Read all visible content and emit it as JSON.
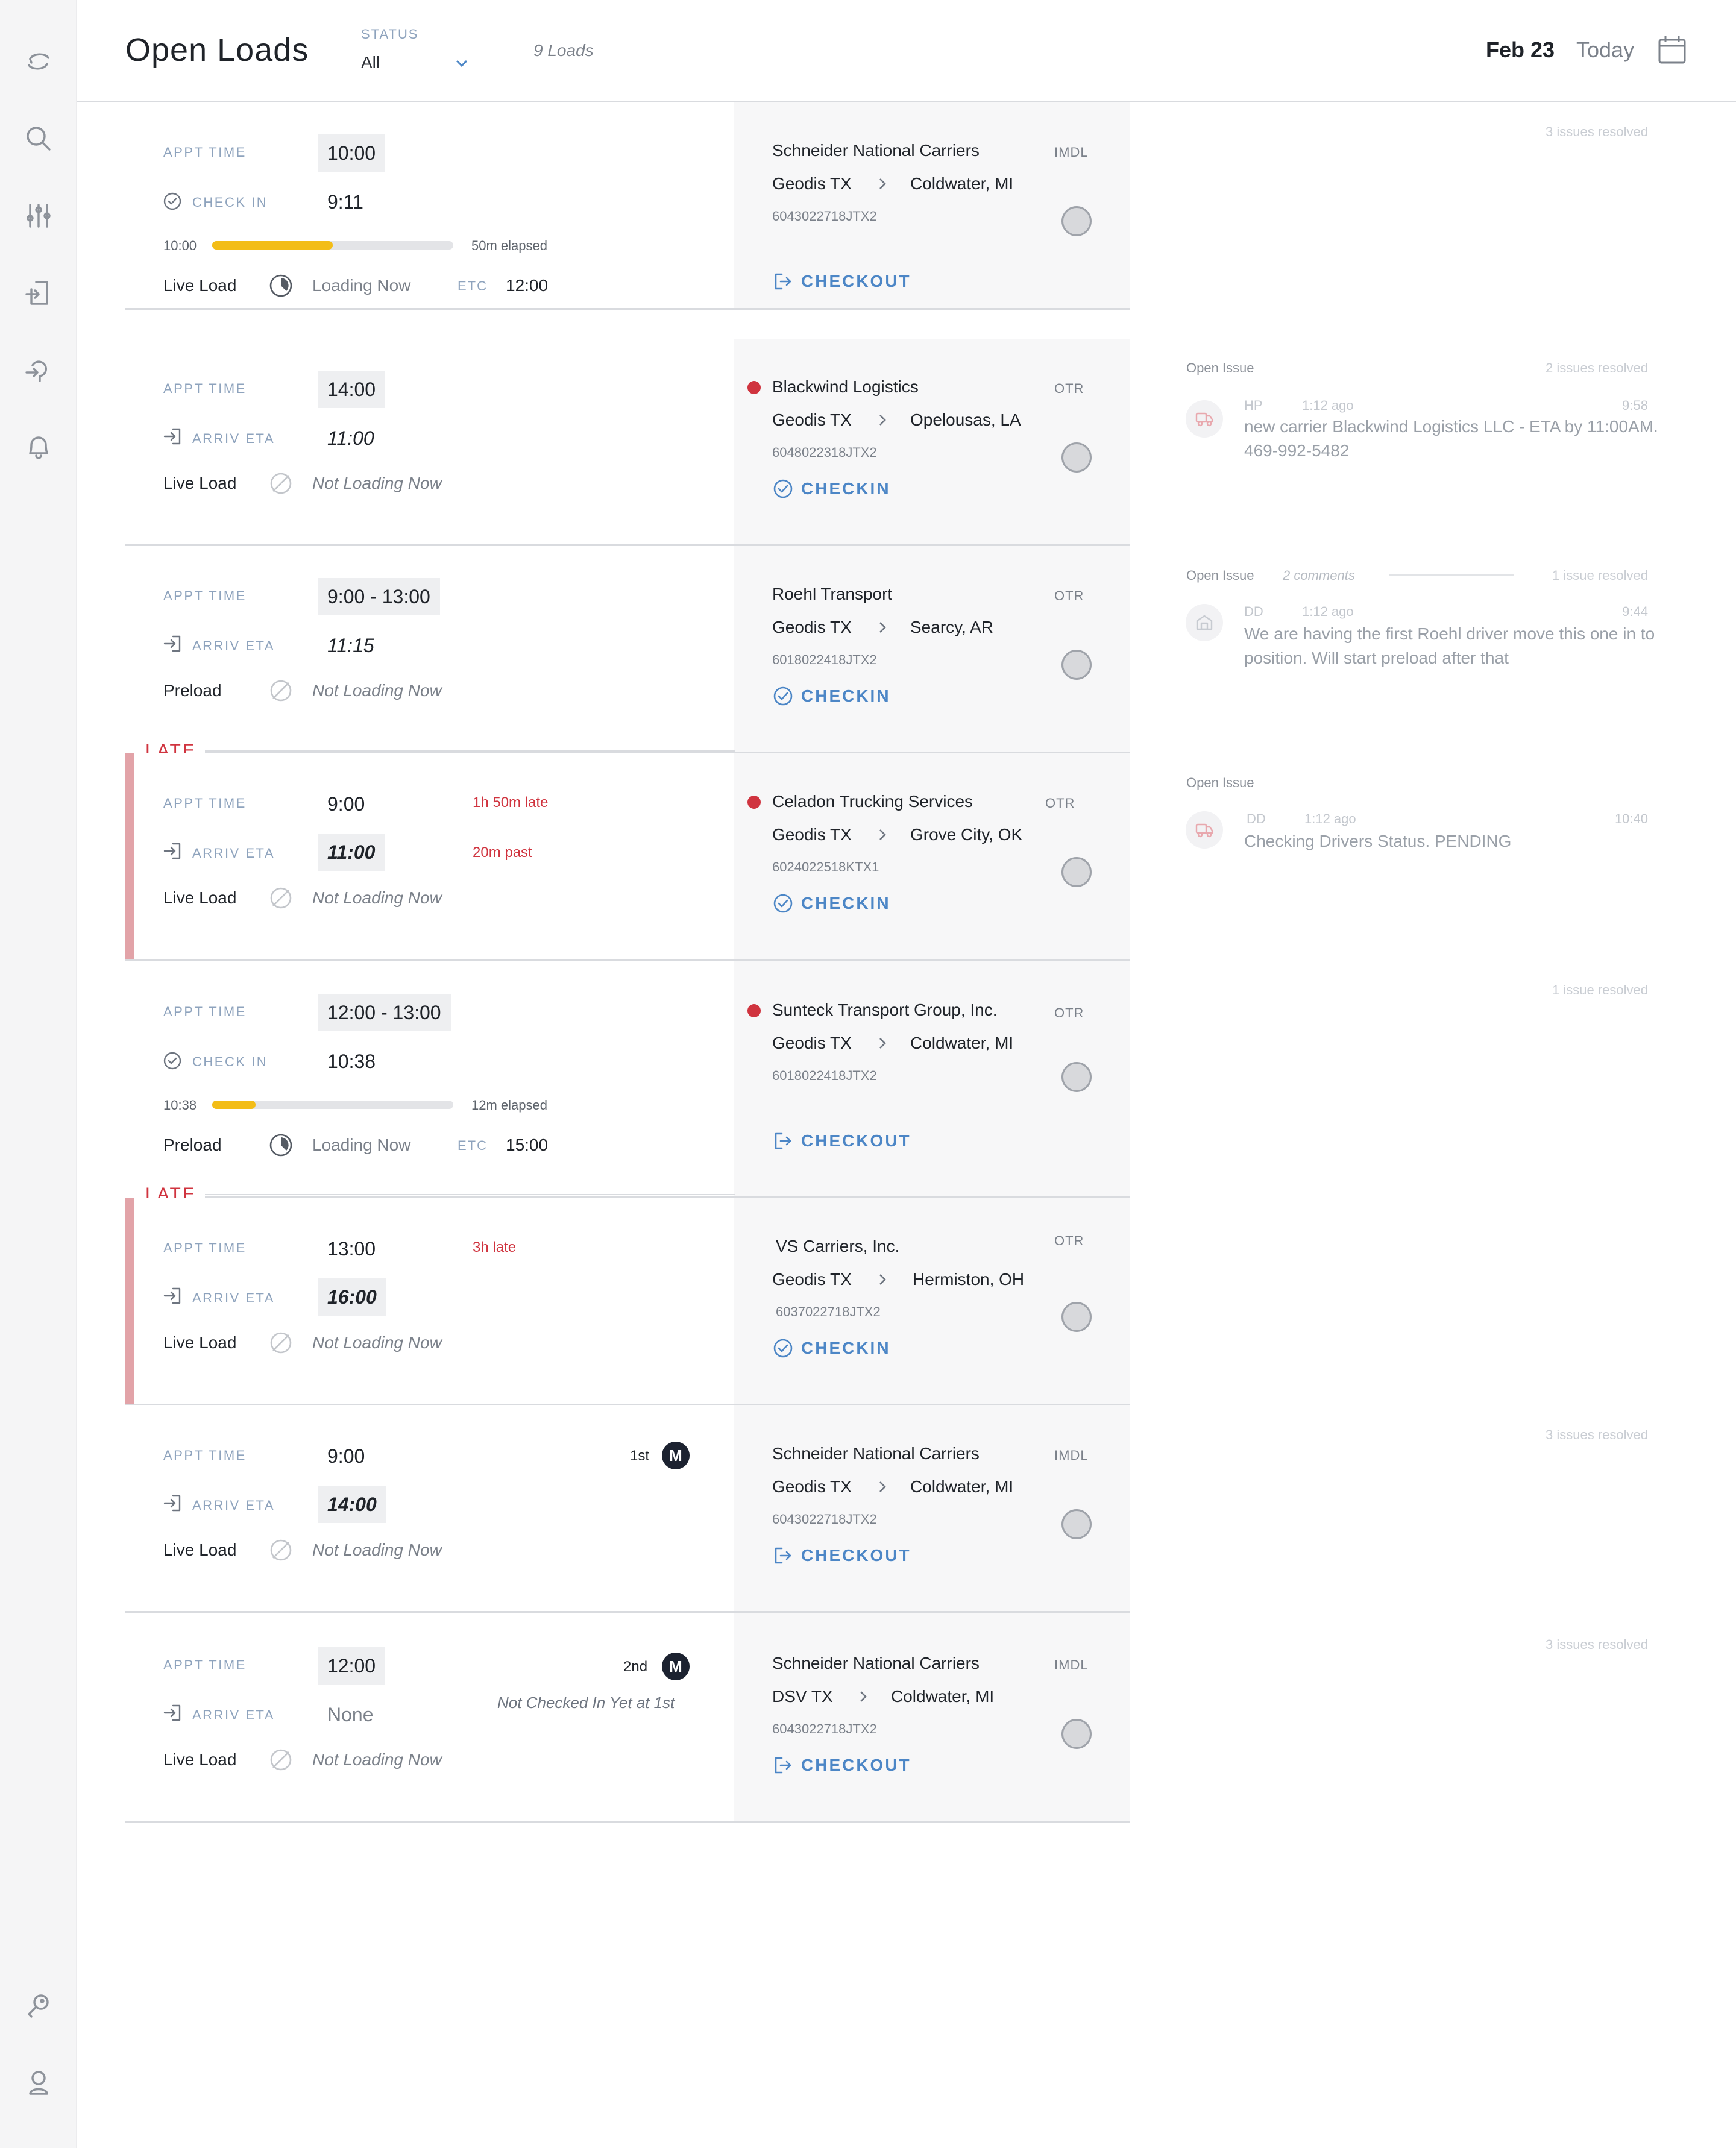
{
  "header": {
    "title": "Open Loads",
    "status_label": "STATUS",
    "status_value": "All",
    "loads_count": "9 Loads",
    "date": "Feb 23",
    "today": "Today"
  },
  "sidebar": {
    "items": [
      "logo-icon",
      "search-icon",
      "filters-icon",
      "inbound-icon",
      "driver-icon",
      "bell-icon",
      "key-icon",
      "profile-icon"
    ]
  },
  "labels": {
    "appt_time": "APPT TIME",
    "check_in": "CHECK IN",
    "arriv_eta": "ARRIV ETA",
    "etc": "ETC",
    "late": "LATE",
    "open_issue": "Open Issue"
  },
  "loads": [
    {
      "appt": "10:00",
      "second_label": "CHECK IN",
      "second_value": "9:11",
      "progress": {
        "start": "10:00",
        "fraction": 0.5,
        "elapsed": "50m elapsed"
      },
      "load_type": "Live Load",
      "load_status": "Loading Now",
      "etc": "12:00",
      "carrier": "Schneider National Carriers",
      "mode": "IMDL",
      "from": "Geodis TX",
      "to": "Coldwater, MI",
      "ref": "6043022718JTX2",
      "action": "CHECKOUT",
      "resolved": "3 issues resolved"
    },
    {
      "appt": "14:00",
      "second_label": "ARRIV ETA",
      "second_value": "11:00",
      "load_type": "Live Load",
      "load_status": "Not Loading Now",
      "carrier": "Blackwind Logistics",
      "mode": "OTR",
      "from": "Geodis TX",
      "to": "Opelousas, LA",
      "ref": "6048022318JTX2",
      "action": "CHECKIN",
      "resolved": "2 issues resolved",
      "issue": {
        "author": "HP",
        "ago": "1:12 ago",
        "time": "9:58",
        "text": "new carrier Blackwind Logistics LLC - ETA by 11:00AM.  469-992-5482"
      }
    },
    {
      "appt": "9:00 - 13:00",
      "second_label": "ARRIV ETA",
      "second_value": "11:15",
      "load_type": "Preload",
      "load_status": "Not Loading Now",
      "carrier": "Roehl Transport",
      "mode": "OTR",
      "from": "Geodis TX",
      "to": "Searcy, AR",
      "ref": "6018022418JTX2",
      "action": "CHECKIN",
      "resolved": "1 issue resolved",
      "issue": {
        "comments": "2 comments",
        "author": "DD",
        "ago": "1:12 ago",
        "time": "9:44",
        "text": "We are having the first Roehl driver move this one in to position.  Will start preload after that"
      }
    },
    {
      "appt": "9:00",
      "appt_note": "1h 50m late",
      "second_label": "ARRIV ETA",
      "second_value": "11:00",
      "second_note": "20m past",
      "load_type": "Live Load",
      "load_status": "Not Loading Now",
      "carrier": "Celadon Trucking Services",
      "mode": "OTR",
      "from": "Geodis TX",
      "to": "Grove City, OK",
      "ref": "6024022518KTX1",
      "action": "CHECKIN",
      "issue": {
        "author": "DD",
        "ago": "1:12 ago",
        "time": "10:40",
        "text": "Checking Drivers Status. PENDING"
      }
    },
    {
      "appt": "12:00 - 13:00",
      "second_label": "CHECK IN",
      "second_value": "10:38",
      "progress": {
        "start": "10:38",
        "fraction": 0.18,
        "elapsed": "12m elapsed"
      },
      "load_type": "Preload",
      "load_status": "Loading Now",
      "etc": "15:00",
      "carrier": "Sunteck Transport Group, Inc.",
      "mode": "OTR",
      "from": "Geodis TX",
      "to": "Coldwater, MI",
      "ref": "6018022418JTX2",
      "action": "CHECKOUT",
      "resolved": "1 issue resolved"
    },
    {
      "appt": "13:00",
      "appt_note": "3h late",
      "second_label": "ARRIV ETA",
      "second_value": "16:00",
      "load_type": "Live Load",
      "load_status": "Not Loading Now",
      "carrier": "VS Carriers, Inc.",
      "mode": "OTR",
      "from": "Geodis TX",
      "to": "Hermiston, OH",
      "ref": "6037022718JTX2",
      "action": "CHECKIN"
    },
    {
      "appt": "9:00",
      "order": "1st",
      "badge": "M",
      "second_label": "ARRIV ETA",
      "second_value": "14:00",
      "load_type": "Live Load",
      "load_status": "Not Loading Now",
      "carrier": "Schneider National Carriers",
      "mode": "IMDL",
      "from": "Geodis TX",
      "to": "Coldwater, MI",
      "ref": "6043022718JTX2",
      "action": "CHECKOUT",
      "resolved": "3 issues resolved"
    },
    {
      "appt": "12:00",
      "order": "2nd",
      "badge": "M",
      "second_label": "ARRIV ETA",
      "second_value": "None",
      "note": "Not Checked In Yet at 1st",
      "load_type": "Live Load",
      "load_status": "Not Loading Now",
      "carrier": "Schneider National Carriers",
      "mode": "IMDL",
      "from": "DSV TX",
      "to": "Coldwater, MI",
      "ref": "6043022718JTX2",
      "action": "CHECKOUT",
      "resolved": "3 issues resolved"
    }
  ],
  "colors": {
    "accent": "#4c86c6",
    "late": "#d0343f",
    "progress": "#f3bd17",
    "late_bar": "#e2a3a8"
  }
}
